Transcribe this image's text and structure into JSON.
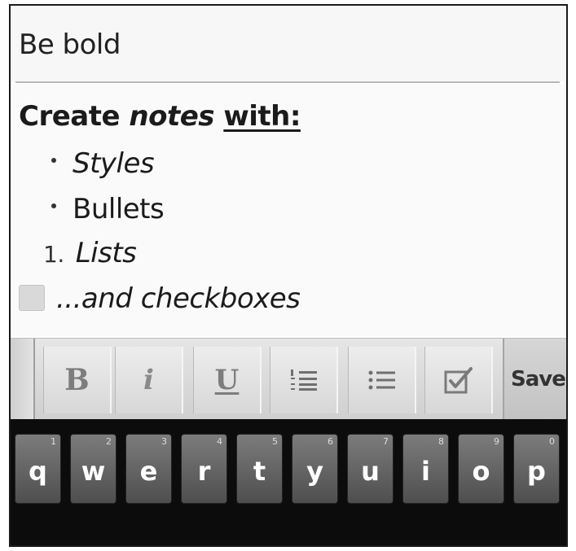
{
  "note": {
    "title": "Be bold",
    "heading": {
      "word1": "Create ",
      "word2": "notes",
      "word3": "with:"
    },
    "items": [
      {
        "type": "bullet",
        "text": "Styles",
        "italic": true
      },
      {
        "type": "bullet",
        "text": "Bullets",
        "italic": false
      },
      {
        "type": "numbered",
        "marker": "1.",
        "text": "Lists",
        "italic": true
      },
      {
        "type": "checkbox",
        "text": "...and checkboxes",
        "italic": true,
        "checked": false
      }
    ]
  },
  "toolbar": {
    "bold_label": "B",
    "italic_label": "i",
    "underline_label": "U",
    "save_label": "Save"
  },
  "keyboard": {
    "keys": [
      {
        "label": "q",
        "hint": "1"
      },
      {
        "label": "w",
        "hint": "2"
      },
      {
        "label": "e",
        "hint": "3"
      },
      {
        "label": "r",
        "hint": "4"
      },
      {
        "label": "t",
        "hint": "5"
      },
      {
        "label": "y",
        "hint": "6"
      },
      {
        "label": "u",
        "hint": "7"
      },
      {
        "label": "i",
        "hint": "8"
      },
      {
        "label": "o",
        "hint": "9"
      },
      {
        "label": "p",
        "hint": "0"
      }
    ]
  },
  "colors": {
    "keyboard_bg": "#0c0c0c",
    "key_face": "#666666",
    "toolbar_bg": "#dcdcdc"
  }
}
